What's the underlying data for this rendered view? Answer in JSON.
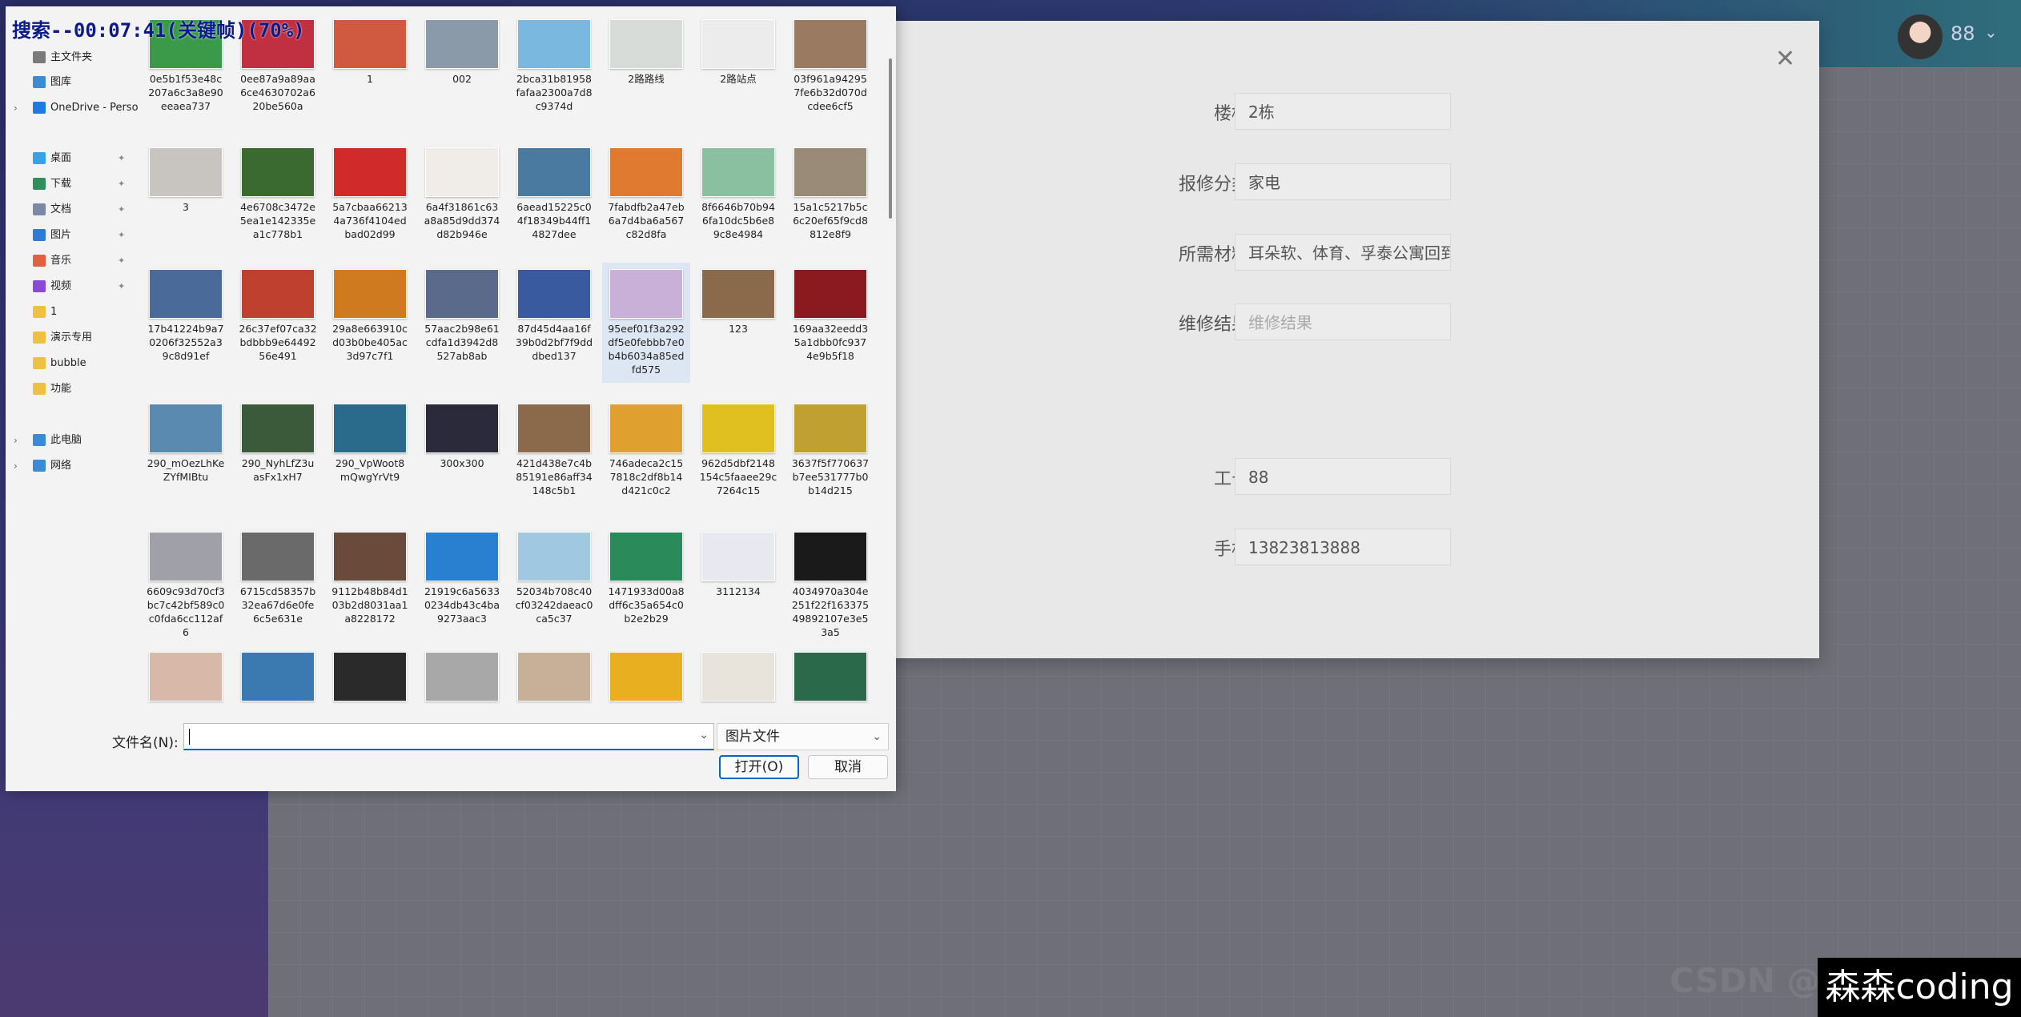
{
  "overlay_title": "搜索--00:07:41(关键帧)(70%)",
  "header": {
    "user_number": "88",
    "chevron_icon": "chevron-down-icon"
  },
  "modal": {
    "close_icon": "close-icon",
    "fields": [
      {
        "label": "楼栋",
        "value": "2栋",
        "placeholder": ""
      },
      {
        "label": "报修分类",
        "value": "家电",
        "placeholder": ""
      },
      {
        "label": "所需材料",
        "value": "耳朵软、体育、孚泰公寓回到",
        "placeholder": ""
      },
      {
        "label": "维修结果",
        "value": "",
        "placeholder": "维修结果"
      },
      {
        "label": "工号",
        "value": "88",
        "placeholder": ""
      },
      {
        "label": "手机",
        "value": "13823813888",
        "placeholder": ""
      }
    ]
  },
  "dialog": {
    "nav": [
      {
        "label": "主文件夹",
        "icon": "home-icon",
        "color": "#7a7a7a",
        "chevron": false,
        "pinned": false
      },
      {
        "label": "图库",
        "icon": "gallery-icon",
        "color": "#3a8ad6",
        "chevron": false,
        "pinned": false
      },
      {
        "label": "OneDrive - Perso",
        "icon": "cloud-icon",
        "color": "#1f7ae0",
        "chevron": true,
        "pinned": false
      },
      {
        "label": "桌面",
        "icon": "desktop-icon",
        "color": "#3aa0e8",
        "chevron": false,
        "pinned": true
      },
      {
        "label": "下载",
        "icon": "download-icon",
        "color": "#2f8f5a",
        "chevron": false,
        "pinned": true
      },
      {
        "label": "文档",
        "icon": "document-icon",
        "color": "#7a8aa6",
        "chevron": false,
        "pinned": true
      },
      {
        "label": "图片",
        "icon": "picture-icon",
        "color": "#2f7ad6",
        "chevron": false,
        "pinned": true
      },
      {
        "label": "音乐",
        "icon": "music-icon",
        "color": "#e06040",
        "chevron": false,
        "pinned": true
      },
      {
        "label": "视频",
        "icon": "video-icon",
        "color": "#8a4ad6",
        "chevron": false,
        "pinned": true
      },
      {
        "label": "1",
        "icon": "folder-icon",
        "color": "#f0c040",
        "chevron": false,
        "pinned": false
      },
      {
        "label": "演示专用",
        "icon": "folder-icon",
        "color": "#f0c040",
        "chevron": false,
        "pinned": false
      },
      {
        "label": "bubble",
        "icon": "folder-icon",
        "color": "#f0c040",
        "chevron": false,
        "pinned": false
      },
      {
        "label": "功能",
        "icon": "folder-icon",
        "color": "#f0c040",
        "chevron": false,
        "pinned": false
      },
      {
        "label": "此电脑",
        "icon": "computer-icon",
        "color": "#3a8ad6",
        "chevron": true,
        "pinned": false
      },
      {
        "label": "网络",
        "icon": "network-icon",
        "color": "#3a8ad6",
        "chevron": true,
        "pinned": false
      }
    ],
    "files": [
      {
        "name": "0e5b1f53e48c207a6c3a8e90eeaea737",
        "color": "#3a9a4a"
      },
      {
        "name": "0ee87a9a89aa6ce4630702a620be560a",
        "color": "#c03040"
      },
      {
        "name": "1",
        "color": "#d05a40"
      },
      {
        "name": "002",
        "color": "#8a9aa8"
      },
      {
        "name": "2bca31b81958fafaa2300a7d8c9374d",
        "color": "#7ab8e0"
      },
      {
        "name": "2路路线",
        "color": "#d8dcd8"
      },
      {
        "name": "2路站点",
        "color": "#ececec"
      },
      {
        "name": "03f961a942957fe6b32d070dcdee6cf5",
        "color": "#9a7a60"
      },
      {
        "name": "3",
        "color": "#c8c4c0"
      },
      {
        "name": "4e6708c3472e5ea1e142335ea1c778b1",
        "color": "#3a6a30"
      },
      {
        "name": "5a7cbaa662134a736f4104edbad02d99",
        "color": "#d02a2a"
      },
      {
        "name": "6a4f31861c63a8a85d9dd374d82b946e",
        "color": "#f0ece8"
      },
      {
        "name": "6aead15225c04f18349b44ff14827dee",
        "color": "#4a7aa0"
      },
      {
        "name": "7fabdfb2a47eb6a7d4ba6a567c82d8fa",
        "color": "#e07a30"
      },
      {
        "name": "8f6646b70b946fa10dc5b6e89c8e4984",
        "color": "#8ac0a0"
      },
      {
        "name": "15a1c5217b5c6c20ef65f9cd8812e8f9",
        "color": "#9a8a78"
      },
      {
        "name": "17b41224b9a70206f32552a39c8d91ef",
        "color": "#4a6a9a"
      },
      {
        "name": "26c37ef07ca32bdbbb9e6449256e491",
        "color": "#c04030"
      },
      {
        "name": "29a8e663910cd03b0be405ac3d97c7f1",
        "color": "#d07a20"
      },
      {
        "name": "57aac2b98e61cdfa1d3942d8527ab8ab",
        "color": "#5a6a8a"
      },
      {
        "name": "87d45d4aa16f39b0d2bf7f9dddbed137",
        "color": "#3a5aa0"
      },
      {
        "name": "95eef01f3a292df5e0febbb7e0b4b6034a85edfd575",
        "color": "#c8b0d8"
      },
      {
        "name": "123",
        "color": "#8a6a4a"
      },
      {
        "name": "169aa32eedd35a1dbb0fc9374e9b5f18",
        "color": "#8a1a20"
      },
      {
        "name": "290_mOezLhKeZYfMIBtu",
        "color": "#5a8ab0"
      },
      {
        "name": "290_NyhLfZ3uasFx1xH7",
        "color": "#3a5a3a"
      },
      {
        "name": "290_VpWoot8mQwgYrVt9",
        "color": "#2a6a8a"
      },
      {
        "name": "300x300",
        "color": "#2a2a3a"
      },
      {
        "name": "421d438e7c4b85191e86aff34148c5b1",
        "color": "#8a6a4a"
      },
      {
        "name": "746adeca2c157818c2df8b14d421c0c2",
        "color": "#e0a030"
      },
      {
        "name": "962d5dbf2148154c5faaee29c7264c15",
        "color": "#e0c020"
      },
      {
        "name": "3637f5f770637b7ee531777b0b14d215",
        "color": "#c0a030"
      },
      {
        "name": "6609c93d70cf3bc7c42bf589c0c0fda6cc112af6",
        "color": "#a0a0a8"
      },
      {
        "name": "6715cd58357b32ea67d6e0fe6c5e631e",
        "color": "#6a6a6a"
      },
      {
        "name": "9112b48b84d103b2d8031aa1a8228172",
        "color": "#6a4a3a"
      },
      {
        "name": "21919c6a56330234db43c4ba9273aac3",
        "color": "#2a80d0"
      },
      {
        "name": "52034b708c40cf03242daeac0ca5c37",
        "color": "#a0c8e0"
      },
      {
        "name": "1471933d00a8dff6c35a654c0b2e2b29",
        "color": "#2a8a5a"
      },
      {
        "name": "3112134",
        "color": "#e8e8f0"
      },
      {
        "name": "4034970a304e251f22f16337549892107e3e53a5",
        "color": "#1a1a1a"
      },
      {
        "name": "",
        "color": "#d8b8a8"
      },
      {
        "name": "",
        "color": "#3a7ab0"
      },
      {
        "name": "",
        "color": "#2a2a2a"
      },
      {
        "name": "",
        "color": "#a8a8a8"
      },
      {
        "name": "",
        "color": "#c8b098"
      },
      {
        "name": "",
        "color": "#e8b020"
      },
      {
        "name": "",
        "color": "#e8e4dc"
      },
      {
        "name": "",
        "color": "#2a6a4a"
      }
    ],
    "selected_index": 21,
    "filename_label": "文件名(N):",
    "filename_value": "",
    "filetype": "图片文件",
    "open_label": "打开(O)",
    "cancel_label": "取消"
  },
  "watermark": "森森coding",
  "ghost_text": "CSDN @"
}
